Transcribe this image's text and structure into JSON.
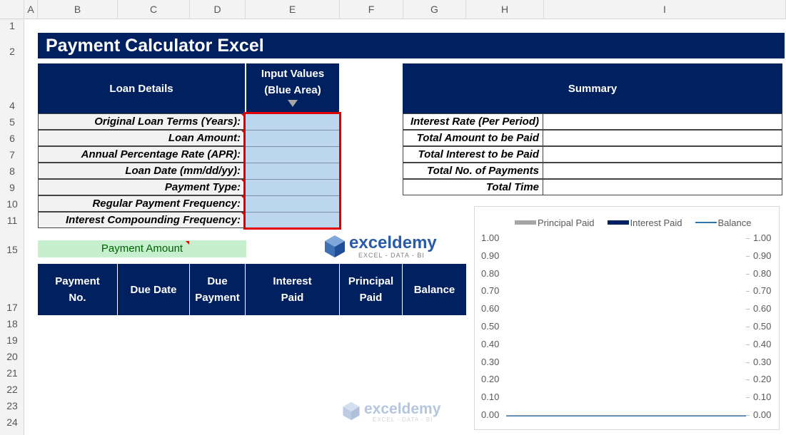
{
  "columns": [
    "A",
    "B",
    "C",
    "D",
    "E",
    "F",
    "G",
    "H",
    "I"
  ],
  "rows": [
    "1",
    "2",
    "4",
    "5",
    "6",
    "7",
    "8",
    "9",
    "10",
    "11",
    "15",
    "17",
    "18",
    "19",
    "20",
    "21",
    "22",
    "23",
    "24"
  ],
  "title": "Payment Calculator Excel",
  "loan": {
    "header": "Loan Details",
    "input_header_line1": "Input Values",
    "input_header_line2": "(Blue Area)",
    "fields": [
      "Original Loan Terms (Years):",
      "Loan Amount:",
      "Annual Percentage Rate (APR):",
      "Loan Date (mm/dd/yy):",
      "Payment Type:",
      "Regular Payment Frequency:",
      "Interest Compounding Frequency:"
    ]
  },
  "summary": {
    "header": "Summary",
    "fields": [
      "Interest Rate (Per Period)",
      "Total Amount to be Paid",
      "Total Interest to be Paid",
      "Total No. of Payments",
      "Total Time"
    ]
  },
  "payment_amount_label": "Payment Amount",
  "schedule_headers": {
    "payment_no_1": "Payment",
    "payment_no_2": "No.",
    "due_date": "Due Date",
    "due_payment_1": "Due",
    "due_payment_2": "Payment",
    "interest_paid_1": "Interest",
    "interest_paid_2": "Paid",
    "principal_paid_1": "Principal",
    "principal_paid_2": "Paid",
    "balance": "Balance"
  },
  "logo": {
    "name": "exceldemy",
    "tagline": "EXCEL - DATA - BI"
  },
  "colors": {
    "navy": "#002060",
    "input_blue": "#bdd7ee",
    "highlight_red": "#e00000",
    "payment_green": "#c6efce"
  },
  "chart_data": {
    "type": "line",
    "series": [
      {
        "name": "Principal Paid",
        "color": "#a5a5a5",
        "values": []
      },
      {
        "name": "Interest Paid",
        "color": "#002060",
        "values": []
      },
      {
        "name": "Balance",
        "color": "#2e75b6",
        "values": []
      }
    ],
    "ylim": [
      0,
      1
    ],
    "y_ticks": [
      "0.00",
      "0.10",
      "0.20",
      "0.30",
      "0.40",
      "0.50",
      "0.60",
      "0.70",
      "0.80",
      "0.90",
      "1.00"
    ],
    "y2_ticks": [
      "0.00",
      "0.10",
      "0.20",
      "0.30",
      "0.40",
      "0.50",
      "0.60",
      "0.70",
      "0.80",
      "0.90",
      "1.00"
    ],
    "legend_position": "top",
    "grid": false
  }
}
